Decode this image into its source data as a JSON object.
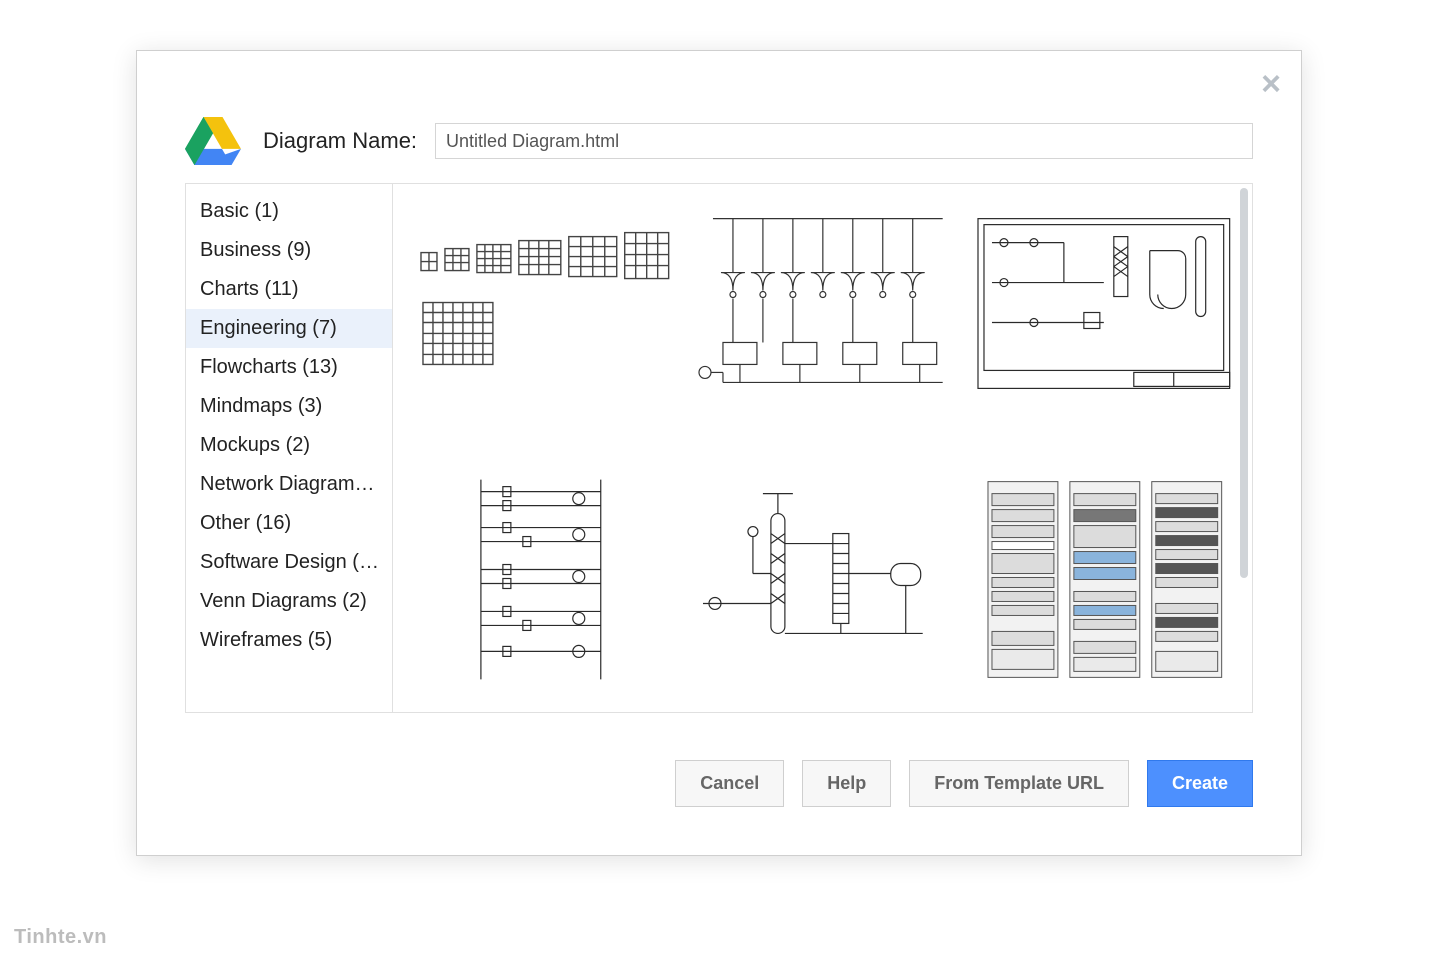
{
  "header": {
    "name_label": "Diagram Name:",
    "name_value": "Untitled Diagram.html"
  },
  "close_label": "×",
  "sidebar": {
    "items": [
      {
        "label": "Basic (1)"
      },
      {
        "label": "Business (9)"
      },
      {
        "label": "Charts (11)"
      },
      {
        "label": "Engineering (7)",
        "selected": true
      },
      {
        "label": "Flowcharts (13)"
      },
      {
        "label": "Mindmaps (3)"
      },
      {
        "label": "Mockups (2)"
      },
      {
        "label": "Network Diagram…"
      },
      {
        "label": "Other (16)"
      },
      {
        "label": "Software Design (…"
      },
      {
        "label": "Venn Diagrams (2)"
      },
      {
        "label": "Wireframes (5)"
      }
    ]
  },
  "templates": [
    {
      "name": "cabinets-grid"
    },
    {
      "name": "logic-circuit"
    },
    {
      "name": "process-schematic-1"
    },
    {
      "name": "ladder-diagram"
    },
    {
      "name": "process-schematic-2"
    },
    {
      "name": "server-racks"
    }
  ],
  "buttons": {
    "cancel": "Cancel",
    "help": "Help",
    "from_url": "From Template URL",
    "create": "Create"
  },
  "watermark": "Tinhte.vn"
}
